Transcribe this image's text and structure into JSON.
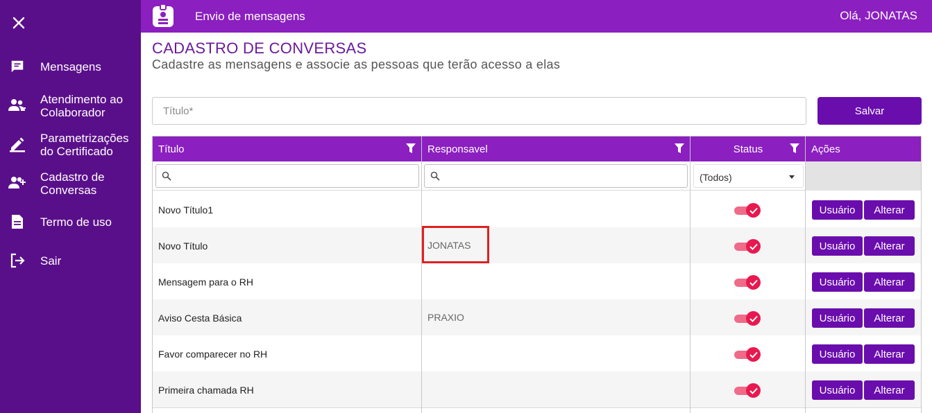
{
  "sidebar": {
    "items": [
      {
        "label_lines": [
          "Mensagens"
        ],
        "icon": "chat-icon"
      },
      {
        "label_lines": [
          "Atendimento ao",
          "Colaborador"
        ],
        "icon": "support-users-icon"
      },
      {
        "label_lines": [
          "Parametrizações",
          "do Certificado"
        ],
        "icon": "pencil-icon"
      },
      {
        "label_lines": [
          "Cadastro de",
          "Conversas"
        ],
        "icon": "add-user-icon"
      },
      {
        "label_lines": [
          "Termo de uso"
        ],
        "icon": "document-icon"
      },
      {
        "label_lines": [
          "Sair"
        ],
        "icon": "logout-icon"
      }
    ]
  },
  "header": {
    "app_title": "Envio de mensagens",
    "greeting": "Olá, JONATAS"
  },
  "page": {
    "title": "CADASTRO DE CONVERSAS",
    "subtitle": "Cadastre as mensagens e associe as pessoas que terão acesso a elas"
  },
  "form": {
    "title_placeholder": "Título*",
    "save_label": "Salvar"
  },
  "table": {
    "columns": [
      "Título",
      "Responsavel",
      "Status",
      "Ações"
    ],
    "status_filter": "(Todos)",
    "rows": [
      {
        "title": "Novo Título1",
        "responsible": "",
        "active": true,
        "user_label": "Usuário",
        "edit_label": "Alterar"
      },
      {
        "title": "Novo Título",
        "responsible": "JONATAS",
        "active": true,
        "user_label": "Usuário",
        "edit_label": "Alterar"
      },
      {
        "title": "Mensagem para o RH",
        "responsible": "",
        "active": true,
        "user_label": "Usuário",
        "edit_label": "Alterar"
      },
      {
        "title": "Aviso Cesta Básica",
        "responsible": "PRAXIO",
        "active": true,
        "user_label": "Usuário",
        "edit_label": "Alterar"
      },
      {
        "title": "Favor comparecer no RH",
        "responsible": "",
        "active": true,
        "user_label": "Usuário",
        "edit_label": "Alterar"
      },
      {
        "title": "Primeira chamada RH",
        "responsible": "",
        "active": true,
        "user_label": "Usuário",
        "edit_label": "Alterar"
      }
    ]
  },
  "colors": {
    "sidebar": "#5a0f8a",
    "topbar": "#8b1fbf",
    "button": "#6a0dad",
    "toggle": "#e8194f",
    "highlight": "#e02020"
  }
}
